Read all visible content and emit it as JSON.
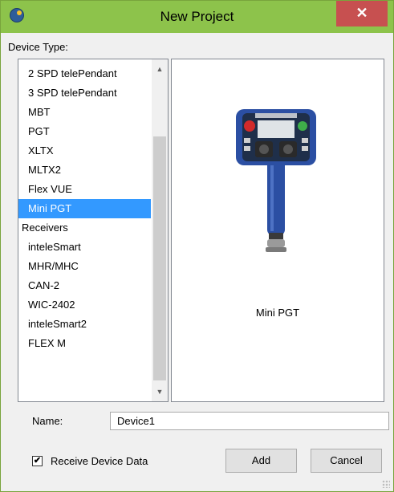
{
  "window": {
    "title": "New Project",
    "close_glyph": "✕",
    "accent": "#8dc34b"
  },
  "device_type_label": "Device Type:",
  "device_list": {
    "items": [
      {
        "label": "2 SPD telePendant",
        "kind": "child"
      },
      {
        "label": "3 SPD telePendant",
        "kind": "child"
      },
      {
        "label": "MBT",
        "kind": "child"
      },
      {
        "label": "PGT",
        "kind": "child"
      },
      {
        "label": "XLTX",
        "kind": "child"
      },
      {
        "label": "MLTX2",
        "kind": "child"
      },
      {
        "label": "Flex VUE",
        "kind": "child"
      },
      {
        "label": "Mini PGT",
        "kind": "child",
        "selected": true
      },
      {
        "label": "Receivers",
        "kind": "group"
      },
      {
        "label": "inteleSmart",
        "kind": "child"
      },
      {
        "label": "MHR/MHC",
        "kind": "child"
      },
      {
        "label": "CAN-2",
        "kind": "child"
      },
      {
        "label": "WIC-2402",
        "kind": "child"
      },
      {
        "label": "inteleSmart2",
        "kind": "child"
      },
      {
        "label": "FLEX M",
        "kind": "child"
      }
    ],
    "selection_color": "#3399ff"
  },
  "preview": {
    "caption": "Mini PGT",
    "device_color": "#2b4fa3"
  },
  "name_field": {
    "label": "Name:",
    "value": "Device1"
  },
  "receive_checkbox": {
    "label": "Receive Device Data",
    "checked": true,
    "mark": "✔"
  },
  "buttons": {
    "add": "Add",
    "cancel": "Cancel"
  }
}
